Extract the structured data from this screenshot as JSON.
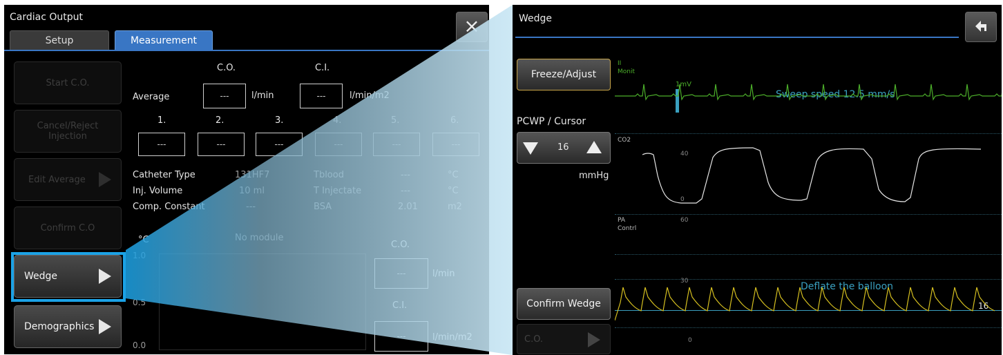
{
  "left": {
    "title": "Cardiac Output",
    "close_label": "×",
    "tabs": {
      "setup": "Setup",
      "measurement": "Measurement"
    },
    "buttons": {
      "start": "Start C.O.",
      "cancel": "Cancel/Reject Injection",
      "edit_average": "Edit Average",
      "confirm": "Confirm C.O",
      "wedge": "Wedge",
      "demographics": "Demographics"
    },
    "co_header": "C.O.",
    "ci_header": "C.I.",
    "average_label": "Average",
    "avg_co_value": "---",
    "avg_co_unit": "l/min",
    "avg_ci_value": "---",
    "avg_ci_unit": "l/min/m2",
    "injection_labels": [
      "1.",
      "2.",
      "3.",
      "4.",
      "5.",
      "6."
    ],
    "injection_values": [
      "---",
      "---",
      "---",
      "---",
      "---",
      "---"
    ],
    "params": {
      "catheter_label": "Catheter Type",
      "catheter_value": "131HF7",
      "tblood_label": "Tblood",
      "tblood_value": "---",
      "tblood_unit": "°C",
      "inj_volume_label": "Inj. Volume",
      "inj_volume_value": "10 ml",
      "tinj_label": "T Injectate",
      "tinj_value": "---",
      "tinj_unit": "°C",
      "comp_label": "Comp. Constant",
      "comp_value": "---",
      "bsa_label": "BSA",
      "bsa_value": "2.01",
      "bsa_unit": "m2"
    },
    "graph": {
      "unit_label": "°C",
      "no_module": "No module",
      "ticks": [
        "1.0",
        "0.5",
        "0.0"
      ],
      "co_label": "C.O.",
      "co_value": "---",
      "co_unit": "l/min",
      "ci_label": "C.I.",
      "ci_value": "---",
      "ci_unit": "l/min/m2"
    }
  },
  "right": {
    "title": "Wedge",
    "freeze_label": "Freeze/Adjust",
    "pcwp_label": "PCWP / Cursor",
    "pcwp_value": "16",
    "pcwp_unit": "mmHg",
    "confirm_wedge_label": "Confirm Wedge",
    "co_button_label": "C.O.",
    "ecg": {
      "lead": "II",
      "mode": "Monit",
      "scale": "1mV",
      "sweep": "Sweep speed 12.5 mm/s",
      "color": "#4caf2a"
    },
    "co2": {
      "label": "CO2",
      "tick_40": "40",
      "tick_0": "0",
      "color": "#e6e6e6"
    },
    "pa": {
      "label": "PA",
      "mode": "Contrl",
      "tick_60": "60",
      "tick_30": "30",
      "tick_0": "0",
      "message": "Deflate the balloon",
      "cursor_value": "16",
      "color": "#d6c020"
    }
  },
  "colors": {
    "accent": "#3976c4",
    "highlight": "#1ba2e6",
    "message": "#3aa0c0"
  }
}
